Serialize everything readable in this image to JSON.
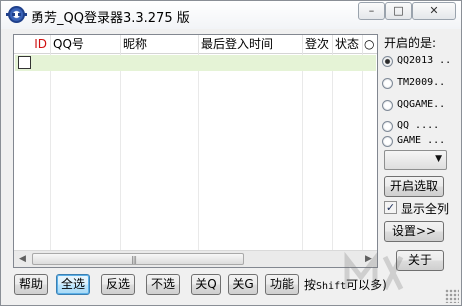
{
  "window": {
    "title": "勇芳_QQ登录器3.3.275 版",
    "buttons": {
      "minimize": "–",
      "maximize": "□",
      "close": "✕"
    }
  },
  "list": {
    "columns": [
      "ID",
      "QQ号",
      "昵称",
      "最后登入时间",
      "登次",
      "状态",
      "○"
    ],
    "rows": [
      {
        "checked": false
      }
    ]
  },
  "scrollbar": {
    "left_arrow": "◀",
    "right_arrow": "▶",
    "grip": "|||"
  },
  "right_panel": {
    "open_label": "开启的是:",
    "radios": [
      {
        "label": "QQ2013 ..",
        "checked": true
      },
      {
        "label": "TM2009..",
        "checked": false
      },
      {
        "label": "QQGAME..",
        "checked": false
      },
      {
        "label": "QQ ....",
        "checked": false
      },
      {
        "label": "GAME ...",
        "checked": false
      }
    ],
    "combo_value": "",
    "combo_arrow": "▼",
    "open_pick_button": "开启选取",
    "show_all_checkbox": {
      "label": "显示全列",
      "checked": true,
      "mark": "✓"
    },
    "settings_button": "设置>>",
    "close_button": "关于"
  },
  "bottom_buttons": [
    "帮助",
    "全选",
    "反选",
    "不选",
    "关Q",
    "关G",
    "功能"
  ],
  "hint": {
    "prefix": "按",
    "key": "Shift",
    "suffix": "可以多)"
  }
}
